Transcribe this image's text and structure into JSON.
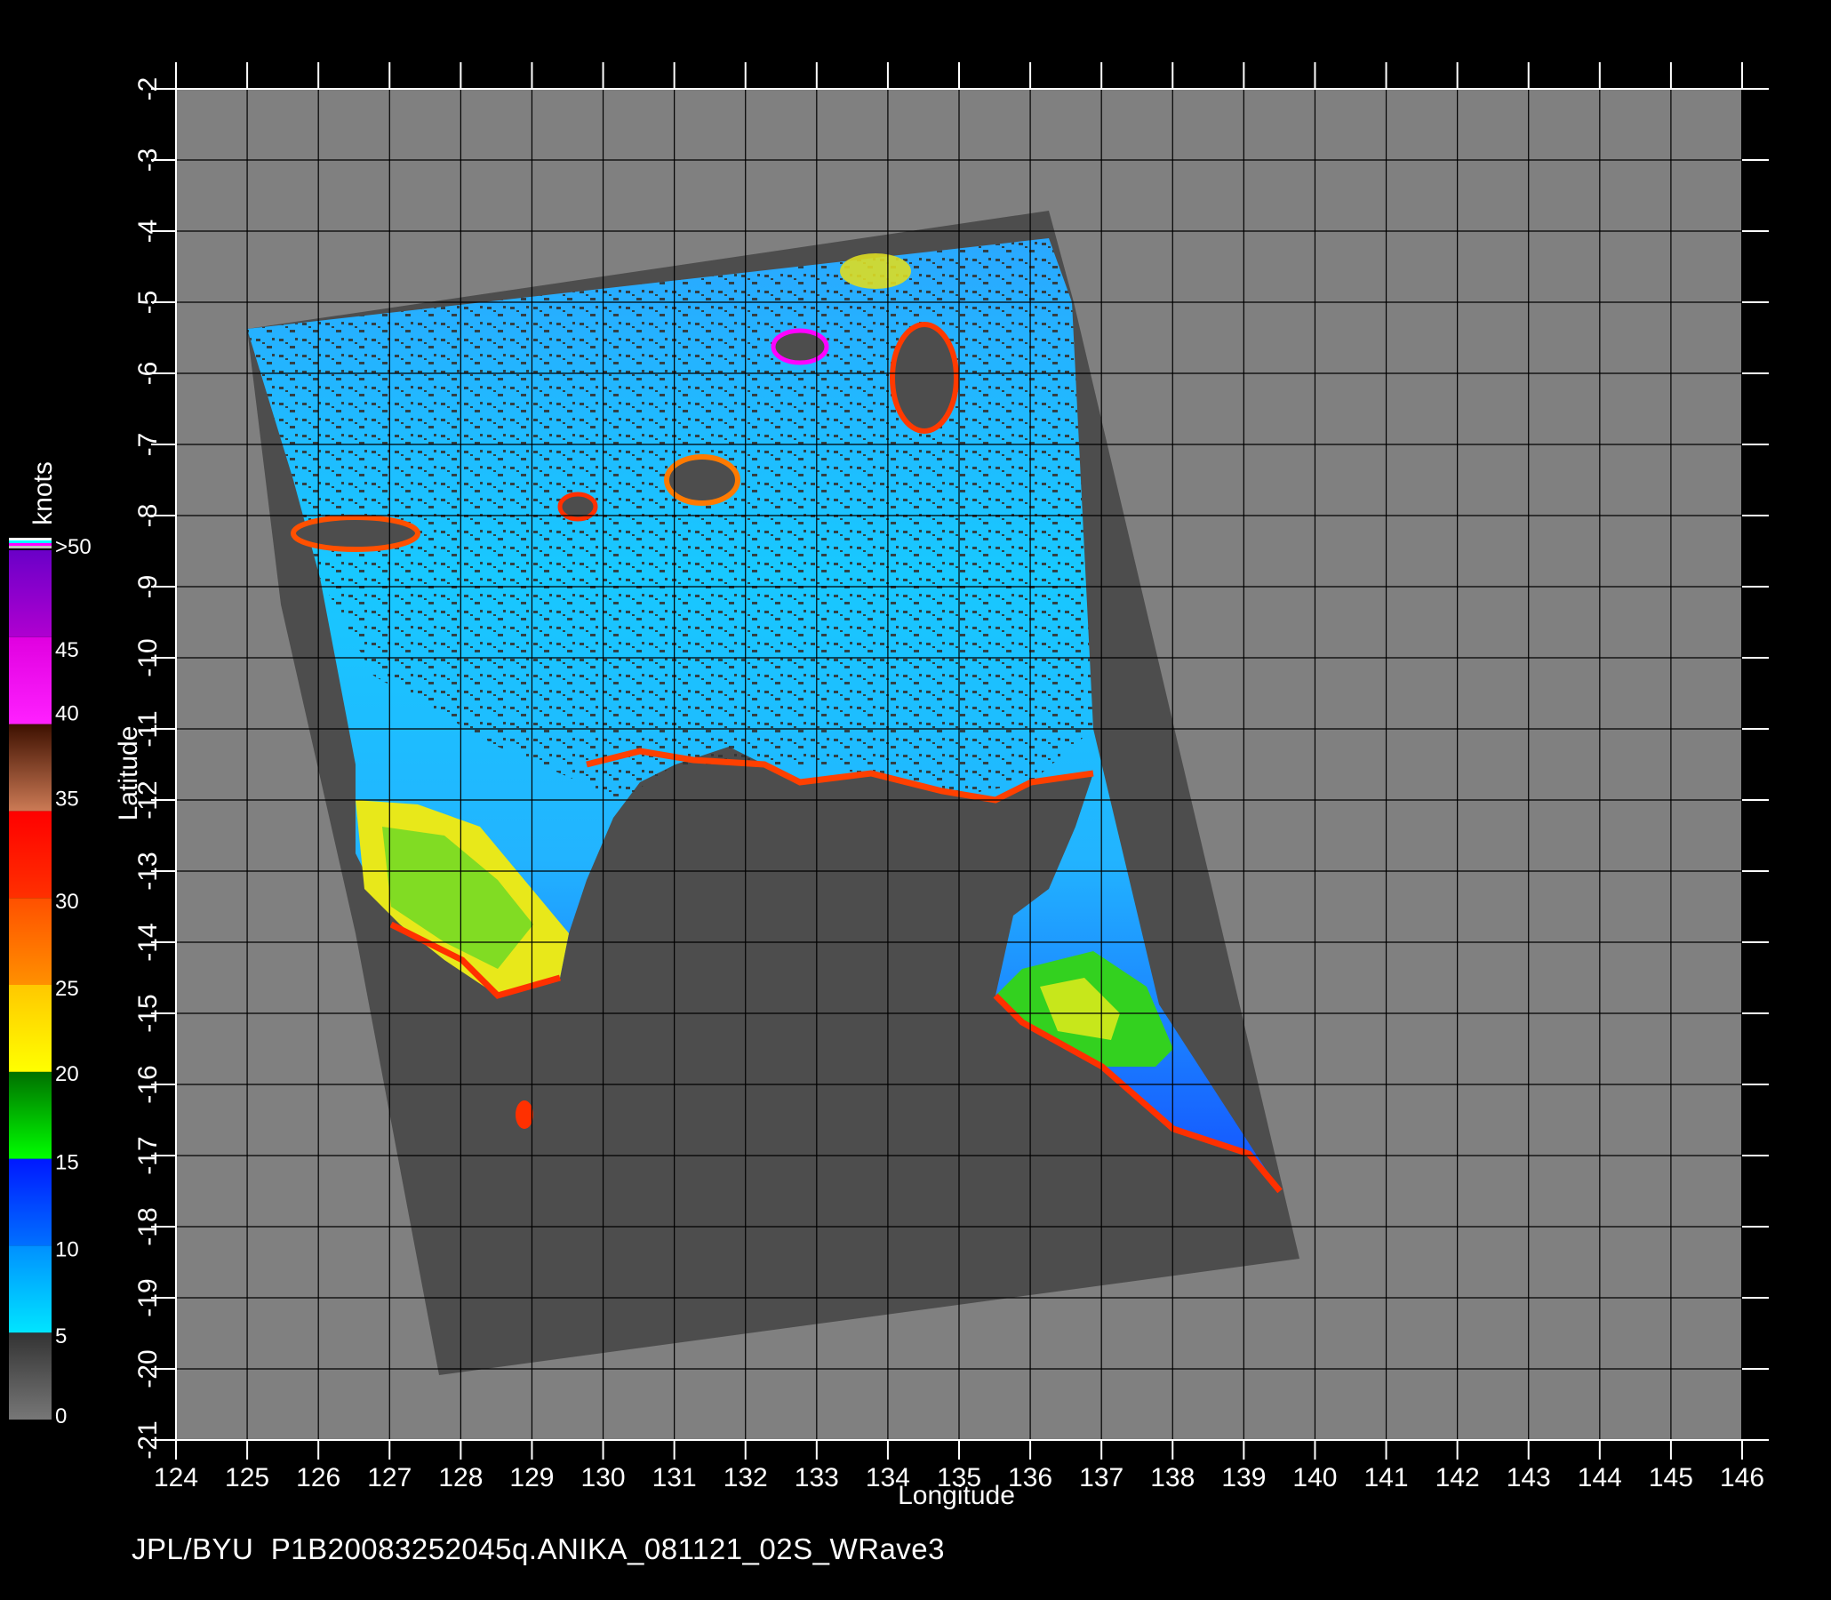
{
  "map": {
    "longitude_label": "Longitude",
    "latitude_label": "Latitude",
    "lon_ticks": [
      "124",
      "125",
      "126",
      "127",
      "128",
      "129",
      "130",
      "131",
      "132",
      "133",
      "134",
      "135",
      "136",
      "137",
      "138",
      "139",
      "140",
      "141",
      "142",
      "143",
      "144",
      "145",
      "146"
    ],
    "lat_ticks": [
      "-2",
      "-3",
      "-4",
      "-5",
      "-6",
      "-7",
      "-8",
      "-9",
      "-10",
      "-11",
      "-12",
      "-13",
      "-14",
      "-15",
      "-16",
      "-17",
      "-18",
      "-19",
      "-20",
      "-21"
    ],
    "lon_range": [
      124,
      146
    ],
    "lat_range": [
      -2,
      -21
    ],
    "grid": true,
    "colors": {
      "background": "#000000",
      "no_data": "#808080",
      "land": "#4d4d4d",
      "grid": "#000000"
    }
  },
  "legend": {
    "units": "knots",
    "labels": [
      ">50",
      "45",
      "40",
      "35",
      "30",
      "25",
      "20",
      "15",
      "10",
      "5",
      "0"
    ],
    "bands": [
      {
        "from": 0,
        "to": 5,
        "colors": [
          "#777777",
          "#333333"
        ]
      },
      {
        "from": 5,
        "to": 10,
        "colors": [
          "#00e5ff",
          "#0090ff"
        ]
      },
      {
        "from": 10,
        "to": 15,
        "colors": [
          "#0070ff",
          "#0018ff"
        ]
      },
      {
        "from": 15,
        "to": 20,
        "colors": [
          "#00ff00",
          "#007000"
        ]
      },
      {
        "from": 20,
        "to": 25,
        "colors": [
          "#ffff00",
          "#ffc800"
        ]
      },
      {
        "from": 25,
        "to": 30,
        "colors": [
          "#ff9000",
          "#ff5000"
        ]
      },
      {
        "from": 30,
        "to": 35,
        "colors": [
          "#ff3000",
          "#ff0000"
        ]
      },
      {
        "from": 35,
        "to": 40,
        "colors": [
          "#cc7a55",
          "#3d1000"
        ]
      },
      {
        "from": 40,
        "to": 45,
        "colors": [
          "#ff20ff",
          "#e000e0"
        ]
      },
      {
        "from": 45,
        "to": 50,
        "colors": [
          "#b000d0",
          "#6a00c8"
        ]
      }
    ]
  },
  "footer": "JPL/BYU  P1B20083252045q.ANIKA_081121_02S_WRave3"
}
